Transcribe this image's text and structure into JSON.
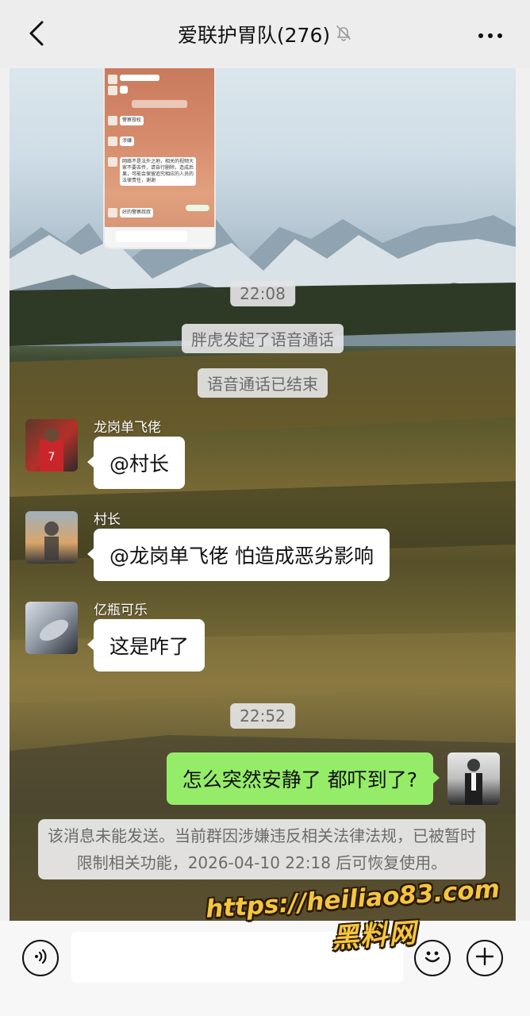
{
  "header": {
    "title": "爱联护胃队(276)",
    "back_icon": "chevron-left-icon",
    "mute_icon": "bell-off-icon",
    "more_icon": "ellipsis-icon"
  },
  "chat": {
    "embedded_screenshot": {
      "lines": [
        "警察授权",
        "涉嫌",
        "网络不是法外之地，相关的视频大家不要去传，请自行删除，造成后果，可能会保留追究相应的人员的法律责任，谢谢",
        "好的警察叔叔"
      ]
    },
    "time_1": "22:08",
    "system_1": "胖虎发起了语音通话",
    "system_2": "语音通话已结束",
    "messages": [
      {
        "sender": "龙岗单飞佬",
        "text": "@村长"
      },
      {
        "sender": "村长",
        "text": "@龙岗单飞佬 怕造成恶劣影响"
      },
      {
        "sender": "亿瓶可乐",
        "text": "这是咋了"
      }
    ],
    "time_2": "22:52",
    "my_message": {
      "text": "怎么突然安静了 都吓到了?"
    },
    "notice": "该消息未能发送。当前群因涉嫌违反相关法律法规，已被暂时限制相关功能，2026-04-10 22:18 后可恢复使用。"
  },
  "input_bar": {
    "voice_icon": "voice-icon",
    "emoji_icon": "emoji-icon",
    "plus_icon": "plus-icon",
    "placeholder": ""
  },
  "watermark": {
    "url": "https://heiliao83.com",
    "name": "黑料网"
  },
  "colors": {
    "header_bg": "#ededed",
    "my_bubble": "#95ec69",
    "other_bubble": "#ffffff",
    "capsule_bg": "#e4e4e4",
    "watermark": "#f5c542"
  }
}
